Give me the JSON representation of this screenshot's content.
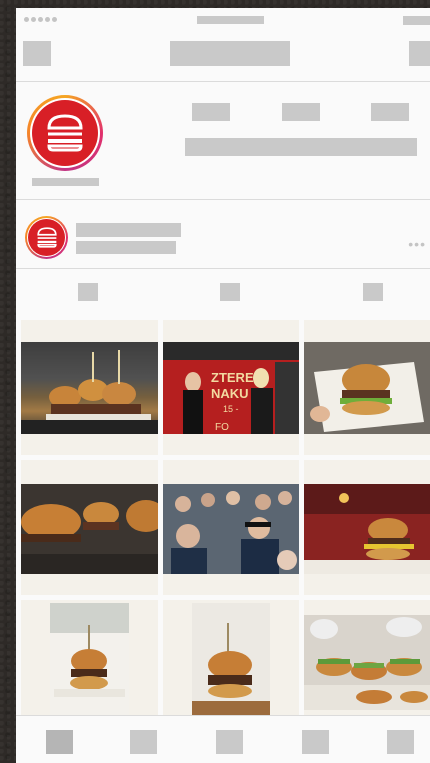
{
  "colors": {
    "skeleton": "#c9c9c9",
    "brand_red": "#d81f26",
    "background": "#fafafa",
    "card": "#f4f1ea"
  },
  "icons": {
    "profile": "burger-logo-icon",
    "more": "more-dots-icon"
  },
  "header": {
    "title": "",
    "back": "back-icon",
    "action": "menu-icon"
  },
  "profile": {
    "username": ""
  },
  "post_author": {
    "name": "",
    "subtitle": ""
  },
  "more_glyph": "•••",
  "grid": {
    "photos": [
      "burger-sliders-on-tray",
      "event-stage-presenters",
      "burger-in-paper-wrap",
      "burgers-close-up",
      "festival-crowd",
      "burger-on-counter",
      "tall-burger-slider",
      "burger-on-board",
      "burgers-being-prepared"
    ]
  },
  "tabbar": {
    "tabs": [
      "home",
      "search",
      "add",
      "activity",
      "profile"
    ]
  }
}
